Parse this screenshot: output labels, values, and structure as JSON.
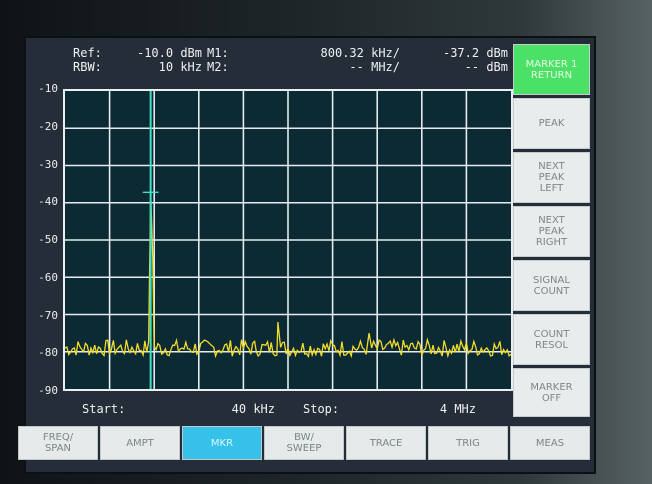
{
  "header": {
    "ref_label": "Ref:",
    "ref_value": "-10.0 dBm",
    "m1_label": "M1:",
    "m1_freq": "800.32 kHz/",
    "m1_level": "-37.2 dBm",
    "rbw_label": "RBW:",
    "rbw_value": "10 kHz",
    "m2_label": "M2:",
    "m2_freq": "-- MHz/",
    "m2_level": "-- dBm"
  },
  "y_axis": {
    "ticks": [
      "-10",
      "-20",
      "-30",
      "-40",
      "-50",
      "-60",
      "-70",
      "-80",
      "-90"
    ],
    "ylim": [
      -90,
      -10
    ]
  },
  "footer": {
    "start_label": "Start:",
    "start_value": "40 kHz",
    "stop_label": "Stop:",
    "stop_value": "4 MHz"
  },
  "softkeys": [
    {
      "label": "MARKER 1\nRETURN",
      "active": true
    },
    {
      "label": "PEAK",
      "active": false
    },
    {
      "label": "NEXT\nPEAK\nLEFT",
      "active": false
    },
    {
      "label": "NEXT\nPEAK\nRIGHT",
      "active": false
    },
    {
      "label": "SIGNAL\nCOUNT",
      "active": false
    },
    {
      "label": "COUNT\nRESOL",
      "active": false
    },
    {
      "label": "MARKER\nOFF",
      "active": false
    }
  ],
  "menu": [
    {
      "label": "FREQ/\nSPAN",
      "active": false
    },
    {
      "label": "AMPT",
      "active": false
    },
    {
      "label": "MKR",
      "active": true
    },
    {
      "label": "BW/\nSWEEP",
      "active": false
    },
    {
      "label": "TRACE",
      "active": false
    },
    {
      "label": "TRIG",
      "active": false
    },
    {
      "label": "MEAS",
      "active": false
    }
  ],
  "colors": {
    "trace": "#f2dc2a",
    "marker_line": "#3fe0c4",
    "grid": "#e6ecee",
    "plot_bg": "#0b2a34",
    "softkey_active": "#4be066",
    "menu_active": "#36c1ea"
  },
  "chart_data": {
    "type": "line",
    "x_unit": "MHz",
    "xlim": [
      0.04,
      4
    ],
    "ylim": [
      -90,
      -10
    ],
    "y_unit": "dBm",
    "grid": true,
    "marker": {
      "name": "M1",
      "x": 0.80032,
      "y": -37.2
    },
    "noise_floor": -79,
    "peaks": [
      {
        "x": 0.80032,
        "y": -37.2
      },
      {
        "x": 0.82,
        "y": -55
      },
      {
        "x": 1.93,
        "y": -72
      },
      {
        "x": 2.74,
        "y": -75
      }
    ]
  }
}
